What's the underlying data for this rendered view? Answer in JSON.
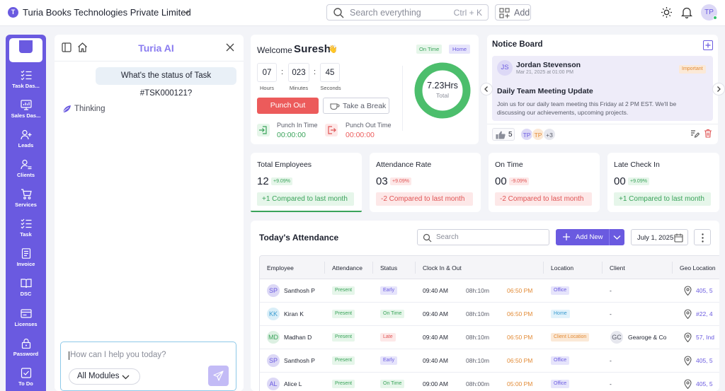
{
  "topbar": {
    "company_initial": "T",
    "company_name": "Turia Books Technologies Private Limited",
    "search_placeholder": "Search everything",
    "search_shortcut": "Ctrl + K",
    "add_label": "Add",
    "user_initials": "TP"
  },
  "sidebar": {
    "items": [
      {
        "label": "Task Das...",
        "icon": "task-list-icon"
      },
      {
        "label": "Sales Das...",
        "icon": "monitor-chart-icon"
      },
      {
        "label": "Leads",
        "icon": "user-plus-icon"
      },
      {
        "label": "Clients",
        "icon": "user-list-icon"
      },
      {
        "label": "Services",
        "icon": "cart-icon"
      },
      {
        "label": "Task",
        "icon": "task-list-icon"
      },
      {
        "label": "Invoice",
        "icon": "invoice-icon"
      },
      {
        "label": "DSC",
        "icon": "book-icon"
      },
      {
        "label": "Licenses",
        "icon": "card-icon"
      },
      {
        "label": "Password",
        "icon": "lock-icon"
      },
      {
        "label": "To Do",
        "icon": "checkbox-icon"
      }
    ]
  },
  "ai": {
    "title": "Turia AI",
    "user_message": "What's the status of Task #TSK000121?",
    "thinking": "Thinking",
    "input_placeholder": "How can I help you today?",
    "module_select": "All Modules"
  },
  "welcome": {
    "greeting": "Welcome",
    "name": "Suresh",
    "wave": "👋",
    "status_badge": "On Time",
    "location_badge": "Home",
    "hours": "07",
    "minutes": "023",
    "seconds": "45",
    "hours_label": "Hours",
    "minutes_label": "Minutes",
    "seconds_label": "Seconds",
    "punch_out_label": "Punch Out",
    "take_break_label": "Take a Break",
    "punch_in_label": "Punch In Time",
    "punch_in_value": "00:00:00",
    "punch_out_time_label": "Punch Out Time",
    "punch_out_value": "00:00:00",
    "total_hours": "7.23Hrs",
    "total_label": "Total",
    "ring_fraction": 1.0,
    "ring_color": "#4cbe6c"
  },
  "notice": {
    "title": "Notice Board",
    "author_initials": "JS",
    "author": "Jordan Stevenson",
    "date": "Mar 21, 2025 at 01:00 PM",
    "priority": "Important",
    "headline": "Daily Team Meeting Update",
    "body": "Join us for our daily team meeting this Friday at 2 PM EST. We'll be discussing our achievements, upcoming projects.",
    "likes": "5",
    "viewers": [
      "TP",
      "TP",
      "+3"
    ]
  },
  "stats": [
    {
      "title": "Total Employees",
      "value": "12",
      "badge": "+9.09%",
      "compare": "+1 Compared to last month",
      "tone": "green"
    },
    {
      "title": "Attendance Rate",
      "value": "03",
      "badge": "+9.09%",
      "compare": "-2 Compared to last month",
      "tone": "red"
    },
    {
      "title": "On Time",
      "value": "00",
      "badge": "-9.09%",
      "compare": "-2 Compared to last month",
      "tone": "red"
    },
    {
      "title": "Late Check In",
      "value": "00",
      "badge": "+9.09%",
      "compare": "+1 Compared to last month",
      "tone": "green"
    }
  ],
  "attendance": {
    "title": "Today's Attendance",
    "search_placeholder": "Search",
    "add_label": "Add New",
    "date": "July 1, 2025",
    "columns": [
      "Employee",
      "Attendance",
      "Status",
      "Clock In & Out",
      "Location",
      "Client",
      "Geo Location"
    ],
    "rows": [
      {
        "initials": "SP",
        "name": "Santhosh P",
        "attendance": "Present",
        "status": "Early",
        "status_tone": "purple",
        "clock_in": "09:40 AM",
        "hours": "08h:10m",
        "clock_out": "06:50 PM",
        "location": "Office",
        "location_tone": "purple",
        "client_initials": "",
        "client": "-",
        "geo": "405, 5"
      },
      {
        "initials": "KK",
        "name": "Kiran K",
        "attendance": "Present",
        "status": "On Time",
        "status_tone": "green",
        "clock_in": "09:40 AM",
        "hours": "08h:10m",
        "clock_out": "06:50 PM",
        "location": "Home",
        "location_tone": "blue",
        "client_initials": "",
        "client": "-",
        "geo": "#22, 4"
      },
      {
        "initials": "MD",
        "name": "Madhan D",
        "attendance": "Present",
        "status": "Late",
        "status_tone": "red",
        "clock_in": "09:40 AM",
        "hours": "08h:10m",
        "clock_out": "06:50 PM",
        "location": "Client Location",
        "location_tone": "orange",
        "client_initials": "GC",
        "client": "Gearoge & Co",
        "geo": "57, Ind"
      },
      {
        "initials": "SP",
        "name": "Santhosh P",
        "attendance": "Present",
        "status": "Early",
        "status_tone": "purple",
        "clock_in": "09:40 AM",
        "hours": "08h:10m",
        "clock_out": "06:50 PM",
        "location": "Office",
        "location_tone": "purple",
        "client_initials": "",
        "client": "-",
        "geo": "405, 5"
      },
      {
        "initials": "AL",
        "name": "Alice L",
        "attendance": "Present",
        "status": "On Time",
        "status_tone": "green",
        "clock_in": "09:00 AM",
        "hours": "08h:00m",
        "clock_out": "05:00 PM",
        "location": "Office",
        "location_tone": "purple",
        "client_initials": "",
        "client": "-",
        "geo": "405, 5"
      }
    ]
  },
  "colors": {
    "accent": "#6a5ae0",
    "success": "#3aa35a",
    "danger": "#ec5b5b",
    "warning": "#e28a35"
  }
}
